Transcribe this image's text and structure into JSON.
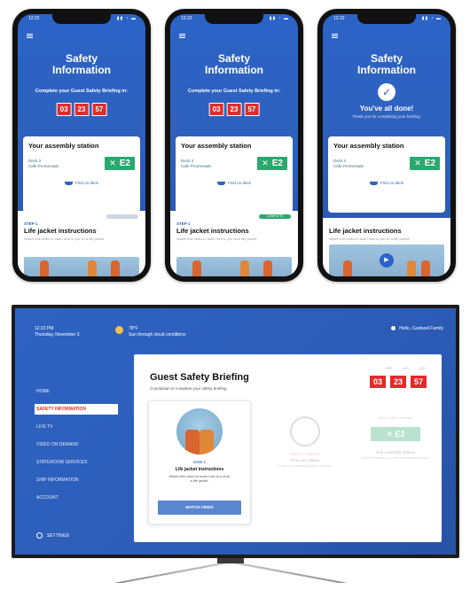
{
  "phones": [
    {
      "status_time": "12:22",
      "title_line1": "Safety",
      "title_line2": "Information",
      "subtitle": "Complete your Guest Safety Briefing in:",
      "countdown": [
        "03",
        "23",
        "57"
      ],
      "card": {
        "title": "Your assembly station",
        "deck_line1": "Deck 3",
        "deck_line2": "Cafe Promenade",
        "station": "E2",
        "find_label": "Find on deck"
      },
      "step": {
        "label": "STEP 1",
        "title": "Life jacket instructions",
        "desc": "Watch this video to learn how to put on a life jacket."
      }
    },
    {
      "status_time": "12:22",
      "title_line1": "Safety",
      "title_line2": "Information",
      "subtitle": "Complete your Guest Safety Briefing in:",
      "countdown": [
        "03",
        "23",
        "57"
      ],
      "card": {
        "title": "Your assembly station",
        "deck_line1": "Deck 3",
        "deck_line2": "Cafe Promenade",
        "station": "E2",
        "find_label": "Find on deck"
      },
      "step": {
        "label": "STEP 1",
        "title": "Life jacket instructions",
        "desc": "Watch this video to learn how to put on a life jacket.",
        "pill": "COMPLETE"
      }
    },
    {
      "status_time": "12:22",
      "title_line1": "Safety",
      "title_line2": "Information",
      "done_title": "You've all done!",
      "done_sub": "Thank you for completing your briefing.",
      "card": {
        "title": "Your assembly station",
        "deck_line1": "Deck 3",
        "deck_line2": "Cafe Promenade",
        "station": "E2",
        "find_label": "Find on deck"
      },
      "step": {
        "title": "Life jacket instructions",
        "desc": "Watch this video to learn how to put on a life jacket."
      }
    }
  ],
  "tv": {
    "time_line1": "12:22 PM",
    "time_line2": "Thursday, November 3",
    "weather_line1": "78°F",
    "weather_line2": "Sun through cloud conditions",
    "guest": "Hello, Cardwell Family",
    "nav": [
      {
        "label": "HOME",
        "active": false
      },
      {
        "label": "SAFETY INFORMATION",
        "active": true
      },
      {
        "label": "LIVE TV",
        "active": false
      },
      {
        "label": "VIDEO ON DEMAND",
        "active": false
      },
      {
        "label": "STATEROOM SERVICES",
        "active": false
      },
      {
        "label": "SHIP INFORMATION",
        "active": false
      },
      {
        "label": "ACCOUNT",
        "active": false
      }
    ],
    "settings": "SETTINGS",
    "panel": {
      "title": "Guest Safety Briefing",
      "subtitle": "Countdown to complete your safety briefing",
      "countdown": [
        "03",
        "23",
        "57"
      ],
      "countdown_labels": [
        "HRS",
        "MIN",
        "SEC"
      ],
      "step_card": {
        "label": "STEP 1",
        "title": "Life jacket instructions",
        "desc": "Watch this video to learn how to put on a life jacket.",
        "button": "WATCH VIDEO"
      },
      "step2": {
        "label": "STEP 2 · LOCKED",
        "title": "Find your station",
        "desc": "Locate your assembly station on board."
      },
      "step3": {
        "top": "Deck 3\nCafe Promenade",
        "station": "E2",
        "title": "Your Assembly Station",
        "desc": "Report here when you hear the emergency signal."
      }
    }
  },
  "colors": {
    "brand_blue": "#2b63c7",
    "countdown_red": "#e32b2b",
    "station_green": "#2aa96e"
  }
}
